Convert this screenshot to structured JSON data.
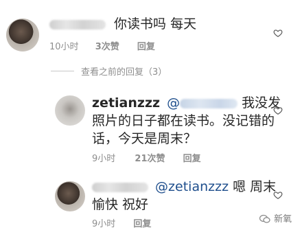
{
  "comment1": {
    "text": "你读书吗 每天",
    "time": "10小时",
    "likes": "3次赞",
    "reply": "回复"
  },
  "view_previous": "查看之前的回复（3）",
  "reply1": {
    "username": "zetianzzz",
    "mention_prefix": "@",
    "text_line1": "我没发",
    "text_line2": "照片的日子都在读书。没记错的",
    "text_line3": "话，今天是周末？",
    "time": "9小时",
    "likes": "21次赞",
    "reply": "回复"
  },
  "reply2": {
    "mention": "@zetianzzz",
    "text_line1": "嗯 周末",
    "text_line2": "愉快 祝好",
    "time": "9小时",
    "reply": "回复"
  },
  "watermark": "新氧",
  "colors": {
    "mention": "#1e4e8c",
    "meta": "#8e8e8e",
    "text": "#262626"
  }
}
